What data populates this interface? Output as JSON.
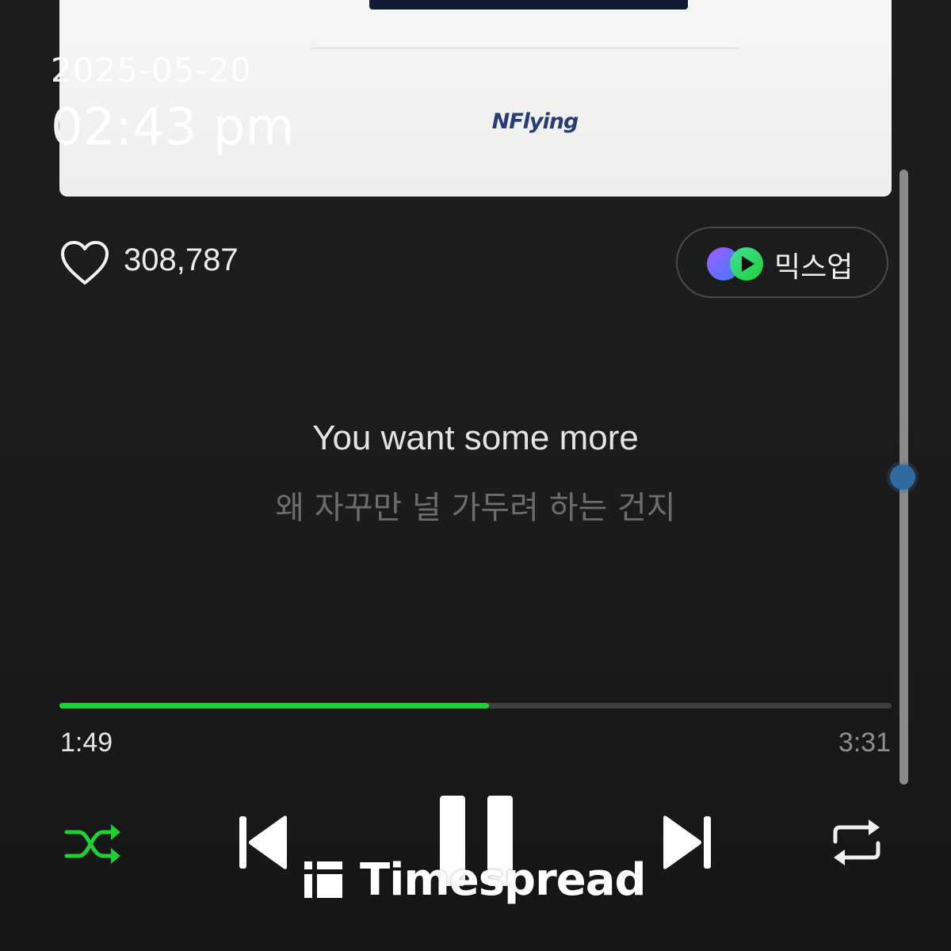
{
  "album": {
    "logo_text": "NFlying"
  },
  "watermark": {
    "date": "2025-05-20",
    "time": "02:43 pm",
    "brand": "Timespread"
  },
  "likes": {
    "count": "308,787",
    "icon": "heart-outline-icon"
  },
  "mixup": {
    "label": "믹스업",
    "icon": "mixup-play-icon"
  },
  "lyrics": {
    "current": "You want some more",
    "next": "왜 자꾸만 널 가두려 하는 건지"
  },
  "playback": {
    "elapsed": "1:49",
    "duration": "3:31",
    "progress_fraction": 0.5166,
    "state": "playing"
  },
  "controls": {
    "shuffle_icon": "shuffle-icon",
    "prev_icon": "skip-previous-icon",
    "pause_icon": "pause-icon",
    "next_icon": "skip-next-icon",
    "repeat_icon": "repeat-icon"
  },
  "colors": {
    "accent": "#1fd134",
    "background": "#1b1b1b",
    "scroll_thumb": "#2f6aa1"
  }
}
